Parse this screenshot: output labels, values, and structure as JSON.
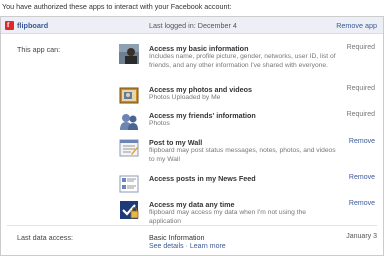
{
  "intro": "You have authorized these apps to interact with your Facebook account:",
  "app": {
    "name": "flipboard",
    "last_login": "Last logged in: December 4",
    "remove_label": "Remove app"
  },
  "permissions_label": "This app can:",
  "permissions": [
    {
      "title": "Access my basic information",
      "description": "Includes name, profile picture, gender, networks, user ID, list of friends, and any other information I've shared with everyone.",
      "status": "Required",
      "icon": "profile-photo-icon"
    },
    {
      "title": "Access my photos and videos",
      "description": "Photos Uploaded by Me",
      "status": "Required",
      "icon": "photos-icon"
    },
    {
      "title": "Access my friends' information",
      "description": "Photos",
      "status": "Required",
      "icon": "friends-icon"
    },
    {
      "title": "Post to my Wall",
      "description": "flipboard may post status messages, notes, photos, and videos to my Wall",
      "status": "Remove",
      "icon": "wall-post-icon"
    },
    {
      "title": "Access posts in my News Feed",
      "description": "",
      "status": "Remove",
      "icon": "news-feed-icon"
    },
    {
      "title": "Access my data any time",
      "description": "flipboard may access my data when I'm not using the application",
      "status": "Remove",
      "icon": "offline-access-icon"
    }
  ],
  "data_access": {
    "label": "Last data access:",
    "title": "Basic Information",
    "see_details": "See details",
    "separator": "·",
    "learn_more": "Learn more",
    "date": "January 3"
  },
  "colors": {
    "link": "#3b5998",
    "header_bg": "#eceff5",
    "logo": "#e12828"
  }
}
